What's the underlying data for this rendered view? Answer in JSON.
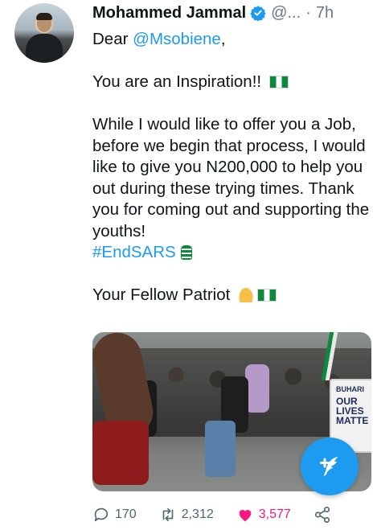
{
  "tweet": {
    "author_name": "Mohammed Jammal",
    "handle": "@...",
    "separator": "·",
    "time": "7h",
    "lines": {
      "greeting_prefix": "Dear ",
      "mention": "@Msobiene",
      "greeting_suffix": ",",
      "inspiration": "You are an Inspiration!!",
      "body": "While I would like to offer you a Job, before we begin that process, I would like to give you N200,000 to help you out during these trying times. Thank you for coming out and supporting the youths!",
      "hashtag": "#EndSARS",
      "signoff": "Your Fellow Patriot"
    },
    "media": {
      "sign_line1": "BUHARI",
      "sign_line2": "OUR LIVES MATTE"
    },
    "stats": {
      "replies": "170",
      "retweets": "2,312",
      "likes": "3,577"
    }
  },
  "colors": {
    "accent": "#1d9bf0",
    "like": "#f91880",
    "muted": "#536471"
  },
  "icons": [
    "verified-badge-icon",
    "nigeria-flag-icon",
    "raised-fist-icon",
    "praying-hands-icon",
    "reply-icon",
    "retweet-icon",
    "heart-icon",
    "share-icon",
    "compose-icon"
  ]
}
